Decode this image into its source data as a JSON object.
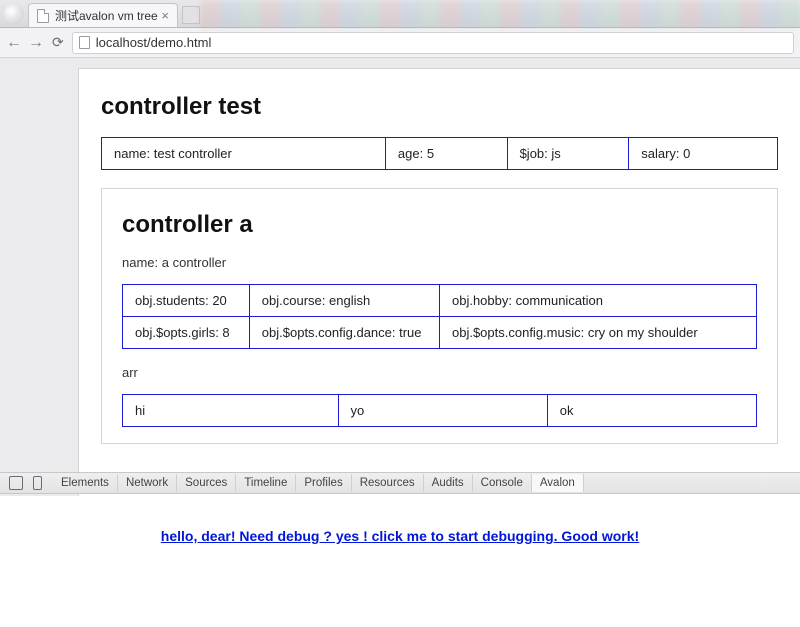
{
  "browser": {
    "tab_title": "测试avalon vm tree",
    "url": "localhost/demo.html"
  },
  "page": {
    "controller_test": {
      "heading": "controller test",
      "row": {
        "name": "name: test controller",
        "age": "age: 5",
        "job": "$job: js",
        "salary": "salary: 0"
      }
    },
    "controller_a": {
      "heading": "controller a",
      "name_line": "name: a controller",
      "table1": {
        "r0": {
          "c0": "obj.students: 20",
          "c1": "obj.course: english",
          "c2": "obj.hobby: communication"
        },
        "r1": {
          "c0": "obj.$opts.girls: 8",
          "c1": "obj.$opts.config.dance: true",
          "c2": "obj.$opts.config.music: cry on my shoulder"
        }
      },
      "arr_label": "arr",
      "arr_row": {
        "c0": "hi",
        "c1": "yo",
        "c2": "ok"
      }
    }
  },
  "devtools": {
    "tabs": {
      "elements": "Elements",
      "network": "Network",
      "sources": "Sources",
      "timeline": "Timeline",
      "profiles": "Profiles",
      "resources": "Resources",
      "audits": "Audits",
      "console": "Console",
      "avalon": "Avalon"
    },
    "debug_link": "hello, dear! Need debug ? yes ! click me to start debugging. Good work!"
  }
}
